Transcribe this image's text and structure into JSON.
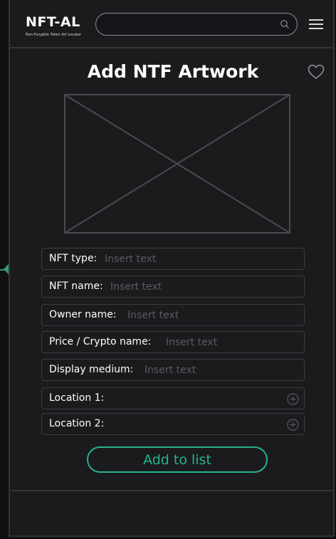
{
  "header": {
    "logo": "NFT-AL",
    "tagline": "Non-Fungible Token Art Locator",
    "search": {
      "value": "",
      "placeholder": ""
    }
  },
  "page": {
    "title": "Add NTF Artwork"
  },
  "fields": [
    {
      "label": "NFT type:",
      "placeholder": "Insert text",
      "value": ""
    },
    {
      "label": "NFT name:",
      "placeholder": "Insert text",
      "value": ""
    },
    {
      "label": "Owner name:",
      "placeholder": "Insert text",
      "value": ""
    },
    {
      "label": "Price / Crypto name:",
      "placeholder": "Insert text",
      "value": ""
    },
    {
      "label": "Display medium:",
      "placeholder": "Insert text",
      "value": ""
    }
  ],
  "locations": [
    {
      "label": "Location 1:"
    },
    {
      "label": "Location 2:"
    }
  ],
  "actions": {
    "add_label": "Add to list"
  },
  "colors": {
    "accent": "#26b38a",
    "background": "#1b1b1e",
    "border": "#353538",
    "placeholder": "#5b5b60"
  },
  "icons": {
    "search": "search-icon",
    "menu": "hamburger-menu-icon",
    "favorite": "heart-icon",
    "add_location": "plus-circle-icon",
    "image": "image-placeholder-icon"
  }
}
